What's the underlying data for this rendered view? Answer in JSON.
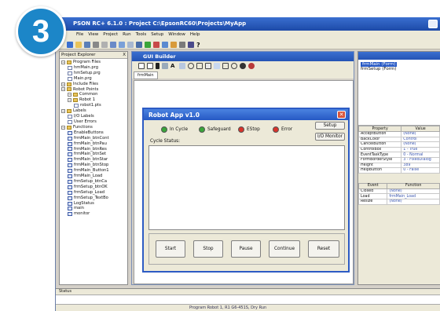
{
  "badge": {
    "number": "3"
  },
  "app": {
    "title": "PSON RC+ 6.1.0 : Project C:\\EpsonRC60\\Projects\\MyApp"
  },
  "menu": [
    "File",
    "View",
    "Project",
    "Run",
    "Tools",
    "Setup",
    "Window",
    "Help"
  ],
  "explorer": {
    "title": "Project Explorer",
    "close": "X",
    "items": [
      {
        "label": "Program Files",
        "type": "folder",
        "level": 0
      },
      {
        "label": "hmMain.prg",
        "type": "file",
        "level": 1
      },
      {
        "label": "hmSetup.prg",
        "type": "file",
        "level": 1
      },
      {
        "label": "Main.prg",
        "type": "file",
        "level": 1
      },
      {
        "label": "Include Files",
        "type": "folder",
        "level": 0
      },
      {
        "label": "Robot Points",
        "type": "folder",
        "level": 0
      },
      {
        "label": "Common",
        "type": "folder",
        "level": 1
      },
      {
        "label": "Robot 1",
        "type": "folder",
        "level": 1
      },
      {
        "label": "robot1.pts",
        "type": "file",
        "level": 2
      },
      {
        "label": "Labels",
        "type": "folder",
        "level": 0
      },
      {
        "label": "I/O Labels",
        "type": "file",
        "level": 1
      },
      {
        "label": "User Errors",
        "type": "file",
        "level": 1
      },
      {
        "label": "Functions",
        "type": "folder",
        "level": 0
      },
      {
        "label": "EnableButtons",
        "type": "func",
        "level": 1
      },
      {
        "label": "frmMain_btnCont",
        "type": "func",
        "level": 1
      },
      {
        "label": "frmMain_btnPau",
        "type": "func",
        "level": 1
      },
      {
        "label": "frmMain_btnRes",
        "type": "func",
        "level": 1
      },
      {
        "label": "frmMain_btnSet",
        "type": "func",
        "level": 1
      },
      {
        "label": "frmMain_btnStar",
        "type": "func",
        "level": 1
      },
      {
        "label": "frmMain_btnStop",
        "type": "func",
        "level": 1
      },
      {
        "label": "frmMain_Button1",
        "type": "func",
        "level": 1
      },
      {
        "label": "frmMain_Load",
        "type": "func",
        "level": 1
      },
      {
        "label": "frmSetup_btnCa",
        "type": "func",
        "level": 1
      },
      {
        "label": "frmSetup_btnOK",
        "type": "func",
        "level": 1
      },
      {
        "label": "frmSetup_Load",
        "type": "func",
        "level": 1
      },
      {
        "label": "frmSetup_TextBo",
        "type": "func",
        "level": 1
      },
      {
        "label": "LogStatus",
        "type": "func",
        "level": 1
      },
      {
        "label": "main",
        "type": "func",
        "level": 1
      },
      {
        "label": "monitor",
        "type": "func",
        "level": 1
      }
    ]
  },
  "gui_builder": {
    "title": "GUI Builder",
    "tab": "frmMain",
    "form": {
      "title": "Robot App v1.0",
      "close_glyph": "✕",
      "indicators": [
        {
          "label": "In Cycle",
          "color": "#3aa53a"
        },
        {
          "label": "Safeguard",
          "color": "#3aa53a"
        },
        {
          "label": "EStop",
          "color": "#d8332b"
        },
        {
          "label": "Error",
          "color": "#d8332b"
        }
      ],
      "setup_button": "Setup",
      "io_monitor_button": "I/O Monitor",
      "cycle_status_label": "Cycle Status:",
      "buttons": [
        "Start",
        "Stop",
        "Pause",
        "Continue",
        "Reset"
      ]
    }
  },
  "properties": {
    "tree": [
      "frmMain (Form)",
      "frmSetup (Form)"
    ],
    "columns": [
      "Property",
      "Value"
    ],
    "rows": [
      [
        "AcceptButton",
        "(None)"
      ],
      [
        "BackColor",
        "Control"
      ],
      [
        "CancelButton",
        "(None)"
      ],
      [
        "ControlBox",
        "1 - True"
      ],
      [
        "EventTaskType",
        "0 - Normal"
      ],
      [
        "FormBorderStyle",
        "3 - FixedDialog"
      ],
      [
        "Height",
        "389"
      ],
      [
        "HelpButton",
        "0 - False"
      ]
    ],
    "event_columns": [
      "Event",
      "Function"
    ],
    "events": [
      [
        "Closed",
        "(None)"
      ],
      [
        "Load",
        "frmMain_Load"
      ],
      [
        "Resize",
        "(None)"
      ]
    ]
  },
  "status": {
    "title": "Status",
    "bar": "Program   Robot 1, R1 G6-451S, Dry Run"
  }
}
